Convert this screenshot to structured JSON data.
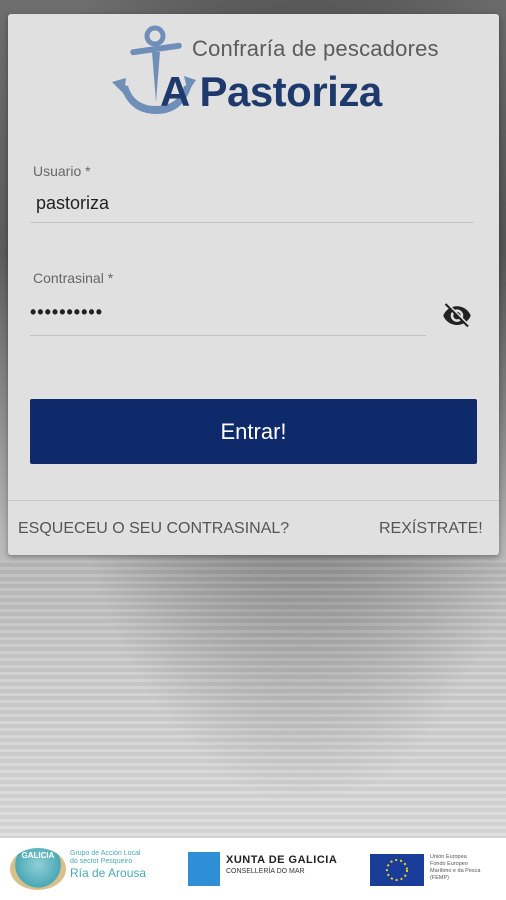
{
  "logo": {
    "tagline": "Confraría de pescadores",
    "name": "A Pastoriza"
  },
  "form": {
    "username_label": "Usuario *",
    "username_value": "pastoriza",
    "password_label": "Contrasinal *",
    "password_value": "••••••••••",
    "submit_label": "Entrar!"
  },
  "links": {
    "forgot_password": "ESQUECEU O SEU CONTRASINAL?",
    "register": "REXÍSTRATE!"
  },
  "footer": {
    "galp_text": "GALICIA",
    "galp_line1": "Grupo de Acción Local",
    "galp_line2": "do sector Pesqueiro",
    "galp_name": "Ría de Arousa",
    "xunta_title": "XUNTA DE GALICIA",
    "xunta_sub": "CONSELLERÍA DO MAR",
    "eu_line1": "Unión Europea",
    "eu_line2": "Fondo Europeo",
    "eu_line3": "Marítimo e da Pesca",
    "eu_line4": "(FEMP)"
  },
  "colors": {
    "primary": "#0f2a6b",
    "card": "#e0e0e0"
  }
}
